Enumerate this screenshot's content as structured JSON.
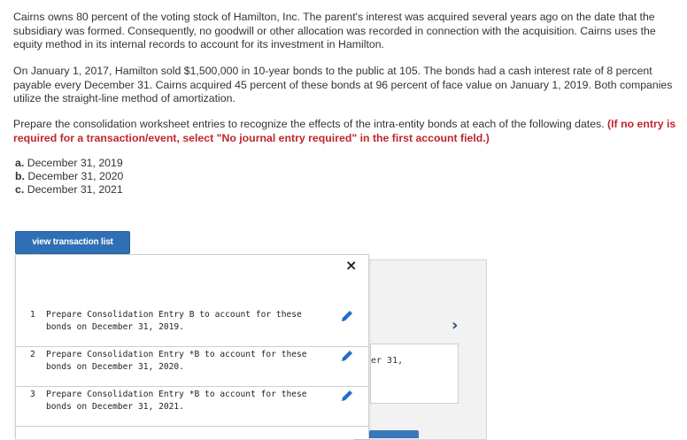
{
  "problem": {
    "paragraph1": "Cairns owns 80 percent of the voting stock of Hamilton, Inc. The parent's interest was acquired several years ago on the date that the subsidiary was formed. Consequently, no goodwill or other allocation was recorded in connection with the acquisition. Cairns uses the equity method in its internal records to account for its investment in Hamilton.",
    "paragraph2": "On January 1, 2017, Hamilton sold $1,500,000 in 10-year bonds to the public at 105. The bonds had a cash interest rate of 8 percent payable every December 31. Cairns acquired 45 percent of these bonds at 96 percent of face value on January 1, 2019. Both companies utilize the straight-line method of amortization.",
    "paragraph3": "Prepare the consolidation worksheet entries to recognize the effects of the intra-entity bonds at each of the following dates.",
    "instruction": "(If no entry is required for a transaction/event, select \"No journal entry required\" in the first account field.)",
    "parts": [
      {
        "letter": "a.",
        "date": "December 31, 2019"
      },
      {
        "letter": "b.",
        "date": "December 31, 2020"
      },
      {
        "letter": "c.",
        "date": "December 31, 2021"
      }
    ]
  },
  "view_button_label": "view transaction list",
  "background": {
    "box_text": "er 31,",
    "chevron": "›"
  },
  "popup": {
    "close_label": "×",
    "rows": [
      {
        "num": "1",
        "text": "Prepare Consolidation Entry B to account for these bonds on December 31, 2019."
      },
      {
        "num": "2",
        "text": "Prepare Consolidation Entry *B to account for these bonds on December 31, 2020."
      },
      {
        "num": "3",
        "text": "Prepare Consolidation Entry *B to account for these bonds on December 31, 2021."
      }
    ]
  },
  "colors": {
    "accent": "#2f6fb5",
    "instruction_red": "#c0262d",
    "edit_icon": "#1f6fc5"
  }
}
